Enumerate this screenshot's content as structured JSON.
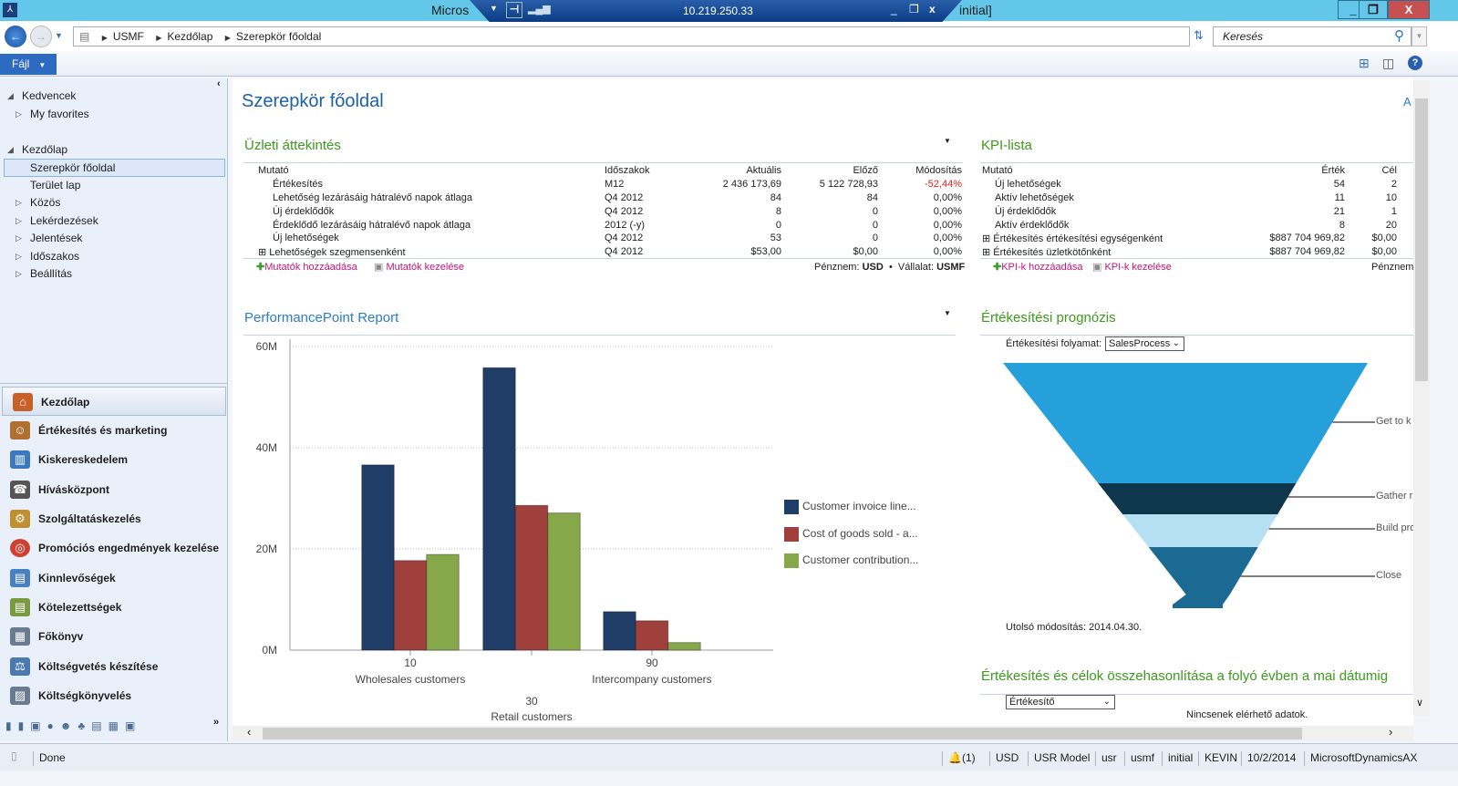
{
  "window": {
    "title_left": "Micros",
    "title_right": "initial]",
    "rdp_address": "10.219.250.33",
    "minimize": "_",
    "restore": "❐",
    "close": "X"
  },
  "address": {
    "crumbs": [
      "USMF",
      "Kezdőlap",
      "Szerepkör főoldal"
    ],
    "search_placeholder": "Keresés"
  },
  "menu": {
    "file": "Fájl"
  },
  "nav": {
    "favorites": "Kedvencek",
    "my_favorites": "My favorites",
    "home": "Kezdőlap",
    "items": [
      "Szerepkör főoldal",
      "Terület lap",
      "Közös",
      "Lekérdezések",
      "Jelentések",
      "Időszakos",
      "Beállítás"
    ],
    "modules": [
      "Kezdőlap",
      "Értékesítés és marketing",
      "Kiskereskedelem",
      "Hívásközpont",
      "Szolgáltatáskezelés",
      "Promóciós engedmények kezelése",
      "Kinnlevőségek",
      "Kötelezettségek",
      "Főkönyv",
      "Költségvetés készítése",
      "Költségkönyvelés"
    ],
    "more": "»"
  },
  "page": {
    "title": "Szerepkör főoldal",
    "corner": "A"
  },
  "overview": {
    "title": "Üzleti áttekintés",
    "headers": [
      "Mutató",
      "Időszakok",
      "Aktuális",
      "Előző",
      "Módosítás"
    ],
    "rows": [
      [
        "Értékesítés",
        "M12",
        "2 436 173,69",
        "5 122 728,93",
        "-52,44%"
      ],
      [
        "Lehetőség lezárásáig hátralévő napok átlaga",
        "Q4 2012",
        "84",
        "84",
        "0,00%"
      ],
      [
        "Új érdeklődők",
        "Q4 2012",
        "8",
        "0",
        "0,00%"
      ],
      [
        "Érdeklődő lezárásáig hátralévő napok átlaga",
        "2012 (-y)",
        "0",
        "0",
        "0,00%"
      ],
      [
        "Új lehetőségek",
        "Q4 2012",
        "53",
        "0",
        "0,00%"
      ],
      [
        "Lehetőségek szegmensenként",
        "Q4 2012",
        "$53,00",
        "$0,00",
        "0,00%"
      ]
    ],
    "add": "Mutatók hozzáadása",
    "manage": "Mutatók kezelése",
    "currency_label": "Pénznem:",
    "currency": "USD",
    "company_label": "Vállalat:",
    "company": "USMF",
    "negative_color": "#e02020"
  },
  "kpi": {
    "title": "KPI-lista",
    "headers": [
      "Mutató",
      "Érték",
      "Cél"
    ],
    "rows": [
      [
        "Új lehetőségek",
        "54",
        "2"
      ],
      [
        "Aktív lehetőségek",
        "11",
        "10"
      ],
      [
        "Új érdeklődők",
        "21",
        "1"
      ],
      [
        "Aktív érdeklődők",
        "8",
        "20"
      ],
      [
        "Értékesítés értékesítési egységenként",
        "$887 704 969,82",
        "$0,00"
      ],
      [
        "Értékesítés üzletkötőnként",
        "$887 704 969,82",
        "$0,00"
      ]
    ],
    "add": "KPI-k hozzáadása",
    "manage": "KPI-k kezelése",
    "currency_label": "Pénznem"
  },
  "pp": {
    "title": "PerformancePoint Report",
    "sub_labels": [
      "Wholesales customers",
      "Retail customers",
      "Intercompany  customers"
    ]
  },
  "chart_data": {
    "type": "bar",
    "categories": [
      "10",
      "30",
      "90"
    ],
    "series": [
      {
        "name": "Customer invoice line...",
        "values": [
          36.6,
          55.8,
          7.6
        ],
        "color": "#1f3d66"
      },
      {
        "name": "Cost of goods sold - a...",
        "values": [
          17.7,
          28.6,
          5.8
        ],
        "color": "#a0403c"
      },
      {
        "name": "Customer contribution...",
        "values": [
          18.9,
          27.1,
          1.5
        ],
        "color": "#86a84a"
      }
    ],
    "yticks": [
      "0M",
      "20M",
      "40M",
      "60M"
    ],
    "ylim": [
      0,
      60
    ],
    "yunit": "M",
    "grid": true,
    "legend": "right"
  },
  "forecast": {
    "title": "Értékesítési prognózis",
    "process_label": "Értékesítési folyamat:",
    "process_value": "SalesProcess",
    "stages": [
      {
        "label": "Get to k",
        "color": "#26a0da"
      },
      {
        "label": "Gather r",
        "color": "#0e364d"
      },
      {
        "label": "Build pro",
        "color": "#b5dff3"
      },
      {
        "label": "Close",
        "color": "#1b6a93"
      }
    ],
    "modified": "Utolsó módosítás: 2014.04.30."
  },
  "compare": {
    "title": "Értékesítés és célok összehasonlítása a folyó évben a mai dátumig",
    "select": "Értékesítő",
    "empty": "Nincsenek elérhető adatok."
  },
  "status": {
    "text": "Done",
    "alerts": "(1)",
    "currency": "USD",
    "model": "USR Model",
    "layer": "usr",
    "company": "usmf",
    "partition": "initial",
    "user": "KEVIN",
    "date": "10/2/2014",
    "server": "MicrosoftDynamicsAX"
  }
}
